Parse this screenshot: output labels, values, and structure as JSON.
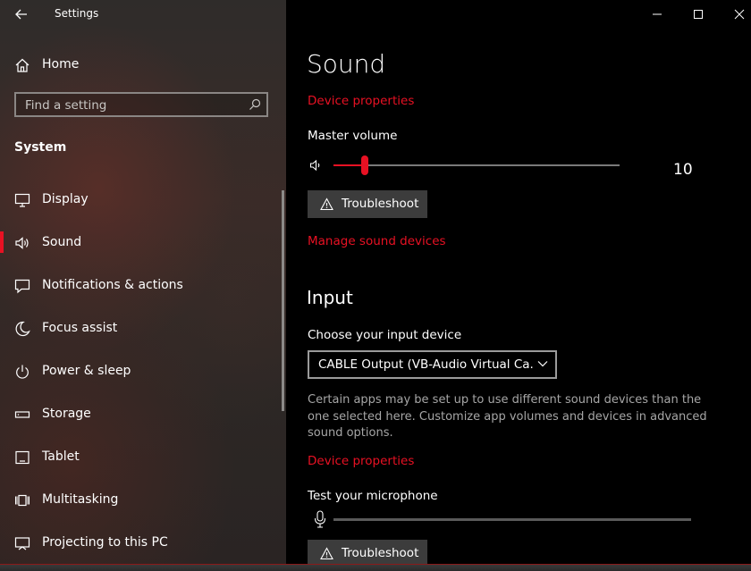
{
  "window": {
    "title": "Settings"
  },
  "sidebar": {
    "home_label": "Home",
    "search_placeholder": "Find a setting",
    "section_title": "System",
    "items": [
      {
        "label": "Display",
        "icon": "display-icon"
      },
      {
        "label": "Sound",
        "icon": "speaker-icon",
        "active": true
      },
      {
        "label": "Notifications & actions",
        "icon": "notification-icon"
      },
      {
        "label": "Focus assist",
        "icon": "moon-icon"
      },
      {
        "label": "Power & sleep",
        "icon": "power-icon"
      },
      {
        "label": "Storage",
        "icon": "storage-icon"
      },
      {
        "label": "Tablet",
        "icon": "tablet-icon"
      },
      {
        "label": "Multitasking",
        "icon": "multitasking-icon"
      },
      {
        "label": "Projecting to this PC",
        "icon": "projecting-icon"
      }
    ]
  },
  "main": {
    "title": "Sound",
    "output_device_properties": "Device properties",
    "master_volume_label": "Master volume",
    "master_volume_value": "10",
    "master_volume_fraction": 0.11,
    "troubleshoot_label": "Troubleshoot",
    "manage_devices_label": "Manage sound devices",
    "input_title": "Input",
    "input_device_label": "Choose your input device",
    "input_device_value": "CABLE Output (VB-Audio Virtual Ca...",
    "input_description": "Certain apps may be set up to use different sound devices than the one selected here. Customize app volumes and devices in advanced sound options.",
    "input_device_properties": "Device properties",
    "test_mic_label": "Test your microphone",
    "mic_level_fraction": 0,
    "troubleshoot_input_label": "Troubleshoot"
  },
  "colors": {
    "accent": "#e81123",
    "background": "#000000",
    "button": "#3c3c3c"
  }
}
